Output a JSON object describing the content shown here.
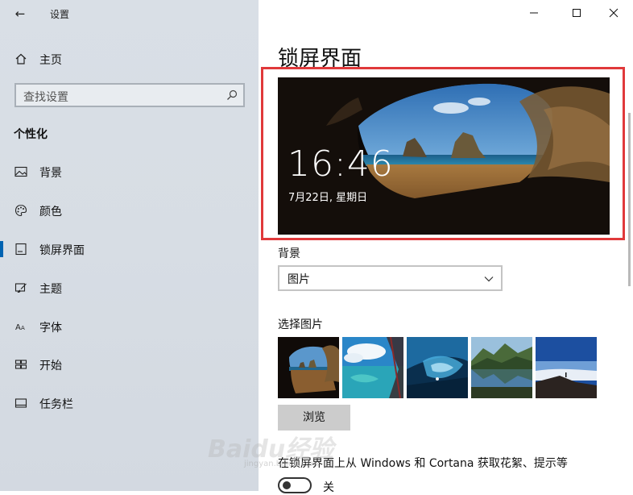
{
  "app": {
    "back_glyph": "←",
    "title": "设置"
  },
  "window_controls": {
    "minimize": "minimize-icon",
    "maximize": "maximize-icon",
    "close": "close-icon"
  },
  "sidebar": {
    "home_label": "主页",
    "search_placeholder": "查找设置",
    "section_title": "个性化",
    "items": [
      {
        "label": "背景",
        "icon": "picture-icon",
        "active": false
      },
      {
        "label": "颜色",
        "icon": "palette-icon",
        "active": false
      },
      {
        "label": "锁屏界面",
        "icon": "lockscreen-icon",
        "active": true
      },
      {
        "label": "主题",
        "icon": "theme-icon",
        "active": false
      },
      {
        "label": "字体",
        "icon": "font-icon",
        "active": false
      },
      {
        "label": "开始",
        "icon": "start-icon",
        "active": false
      },
      {
        "label": "任务栏",
        "icon": "taskbar-icon",
        "active": false
      }
    ]
  },
  "main": {
    "page_title": "锁屏界面",
    "preview": {
      "time": "16:46",
      "date": "7月22日, 星期日"
    },
    "background_label": "背景",
    "background_value": "图片",
    "choose_picture_label": "选择图片",
    "browse_label": "浏览",
    "cortana_label": "在锁屏界面上从 Windows 和 Cortana 获取花絮、提示等",
    "toggle_state": "关"
  },
  "watermark": {
    "text": "Baidu经验",
    "sub": "jingyan.baidu.com"
  },
  "colors": {
    "accent": "#0063b1",
    "highlight_border": "#e0393b"
  }
}
